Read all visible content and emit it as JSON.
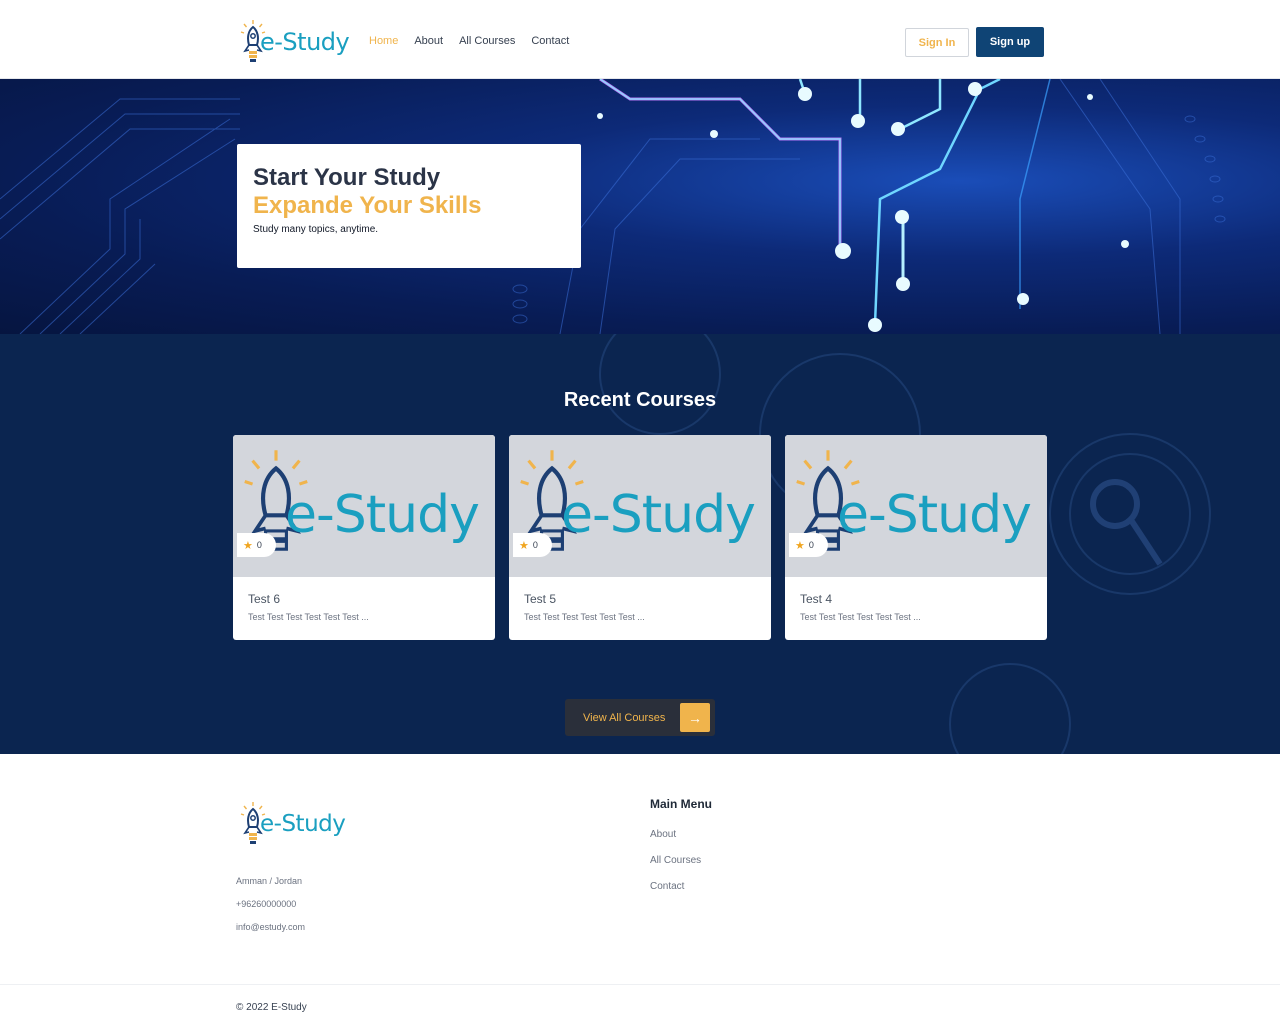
{
  "brand": {
    "name": "e-Study",
    "accent": "#f0b44c",
    "primary": "#0f4475",
    "logo_color": "#1a9fc0"
  },
  "nav": {
    "items": [
      {
        "label": "Home",
        "active": true
      },
      {
        "label": "About",
        "active": false
      },
      {
        "label": "All Courses",
        "active": false
      },
      {
        "label": "Contact",
        "active": false
      }
    ],
    "signin": "Sign In",
    "signup": "Sign up"
  },
  "hero": {
    "title_line1": "Start Your Study",
    "title_line2": "Expande Your Skills",
    "subtitle": "Study many topics, anytime."
  },
  "courses": {
    "title": "Recent Courses",
    "items": [
      {
        "title": "Test 6",
        "desc": "Test Test Test Test Test Test ...",
        "rating": "0",
        "image_logo": "e-Study"
      },
      {
        "title": "Test 5",
        "desc": "Test Test Test Test Test Test ...",
        "rating": "0",
        "image_logo": "e-Study"
      },
      {
        "title": "Test 4",
        "desc": "Test Test Test Test Test Test ...",
        "rating": "0",
        "image_logo": "e-Study"
      }
    ],
    "view_all": "View All Courses"
  },
  "footer": {
    "contact": [
      "Amman / Jordan",
      "+96260000000",
      "info@estudy.com"
    ],
    "menu_title": "Main Menu",
    "menu": [
      "About",
      "All Courses",
      "Contact"
    ],
    "copyright": "© 2022 E-Study"
  }
}
